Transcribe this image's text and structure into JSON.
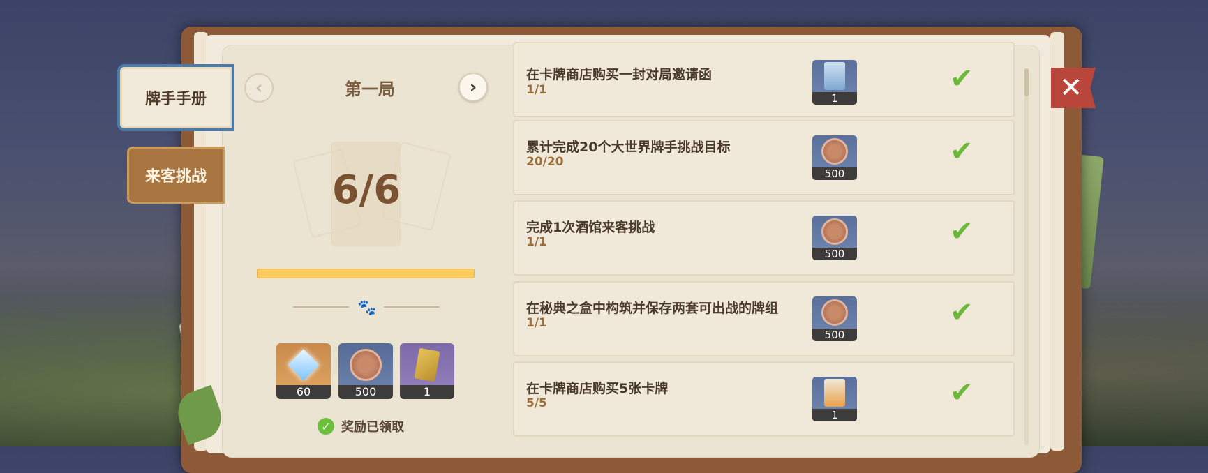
{
  "side_tabs": [
    {
      "label": "牌手手册",
      "active": true
    },
    {
      "label": "来客挑战",
      "active": false
    }
  ],
  "round": {
    "title": "第一局",
    "progress_text": "6/6",
    "progress_fraction": 1.0
  },
  "rewards": [
    {
      "icon": "primogem-icon",
      "amount": "60"
    },
    {
      "icon": "lucky-coin-icon",
      "amount": "500"
    },
    {
      "icon": "card-back-icon",
      "amount": "1"
    }
  ],
  "claimed_label": "奖励已领取",
  "tasks": [
    {
      "title": "在卡牌商店购买一封对局邀请函",
      "progress": "1/1",
      "reward_icon": "invitation-icon",
      "reward_amount": "1",
      "completed": true
    },
    {
      "title": "累计完成20个大世界牌手挑战目标",
      "progress": "20/20",
      "reward_icon": "lucky-coin-icon",
      "reward_amount": "500",
      "completed": true
    },
    {
      "title": "完成1次酒馆来客挑战",
      "progress": "1/1",
      "reward_icon": "lucky-coin-icon",
      "reward_amount": "500",
      "completed": true
    },
    {
      "title": "在秘典之盒中构筑并保存两套可出战的牌组",
      "progress": "1/1",
      "reward_icon": "lucky-coin-icon",
      "reward_amount": "500",
      "completed": true
    },
    {
      "title": "在卡牌商店购买5张卡牌",
      "progress": "5/5",
      "reward_icon": "card-pack-icon",
      "reward_amount": "1",
      "completed": true
    }
  ],
  "colors": {
    "accent_blue": "#4a7ba8",
    "progress_fill": "#fbcb5e",
    "check_green": "#6cb83a",
    "close_red": "#b8463a"
  }
}
